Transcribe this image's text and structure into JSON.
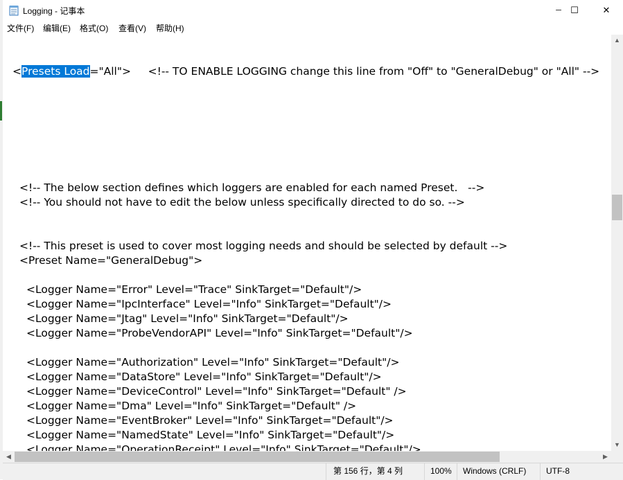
{
  "window": {
    "title": "Logging - 记事本",
    "icon": "notepad-icon",
    "minimize_glyph": "─",
    "maximize_glyph": "☐",
    "close_glyph": "✕"
  },
  "menu": [
    "文件(F)",
    "编辑(E)",
    "格式(O)",
    "查看(V)",
    "帮助(H)"
  ],
  "editor": {
    "selected_text": "Presets Load",
    "line_preset_before": "<",
    "line_preset_after": "=\"All\">     <!-- TO ENABLE LOGGING change this line from \"Off\" to \"GeneralDebug\" or \"All\" -->",
    "lines": [
      "<!-- The below section defines which loggers are enabled for each named Preset.   -->",
      "<!-- You should not have to edit the below unless specifically directed to do so. -->",
      "<!-- This preset is used to cover most logging needs and should be selected by default -->",
      "<Preset Name=\"GeneralDebug\">",
      "<Logger Name=\"Error\" Level=\"Trace\" SinkTarget=\"Default\"/>",
      "<Logger Name=\"IpcInterface\" Level=\"Info\" SinkTarget=\"Default\"/>",
      "<Logger Name=\"Jtag\" Level=\"Info\" SinkTarget=\"Default\"/>",
      "<Logger Name=\"ProbeVendorAPI\" Level=\"Info\" SinkTarget=\"Default\"/>",
      "<Logger Name=\"Authorization\" Level=\"Info\" SinkTarget=\"Default\"/>",
      "<Logger Name=\"DataStore\" Level=\"Info\" SinkTarget=\"Default\"/>",
      "<Logger Name=\"DeviceControl\" Level=\"Info\" SinkTarget=\"Default\" />",
      "<Logger Name=\"Dma\" Level=\"Info\" SinkTarget=\"Default\" />",
      "<Logger Name=\"EventBroker\" Level=\"Info\" SinkTarget=\"Default\"/>",
      "<Logger Name=\"NamedState\" Level=\"Info\" SinkTarget=\"Default\"/>",
      "<Logger Name=\"OperationReceipt\" Level=\"Info\" SinkTarget=\"Default\"/>"
    ]
  },
  "scrollbar": {
    "up_arrow": "▲",
    "down_arrow": "▼",
    "left_arrow": "◀",
    "right_arrow": "▶"
  },
  "status": {
    "position": "第 156 行，第 4 列",
    "zoom": "100%",
    "line_ending": "Windows (CRLF)",
    "encoding": "UTF-8"
  }
}
